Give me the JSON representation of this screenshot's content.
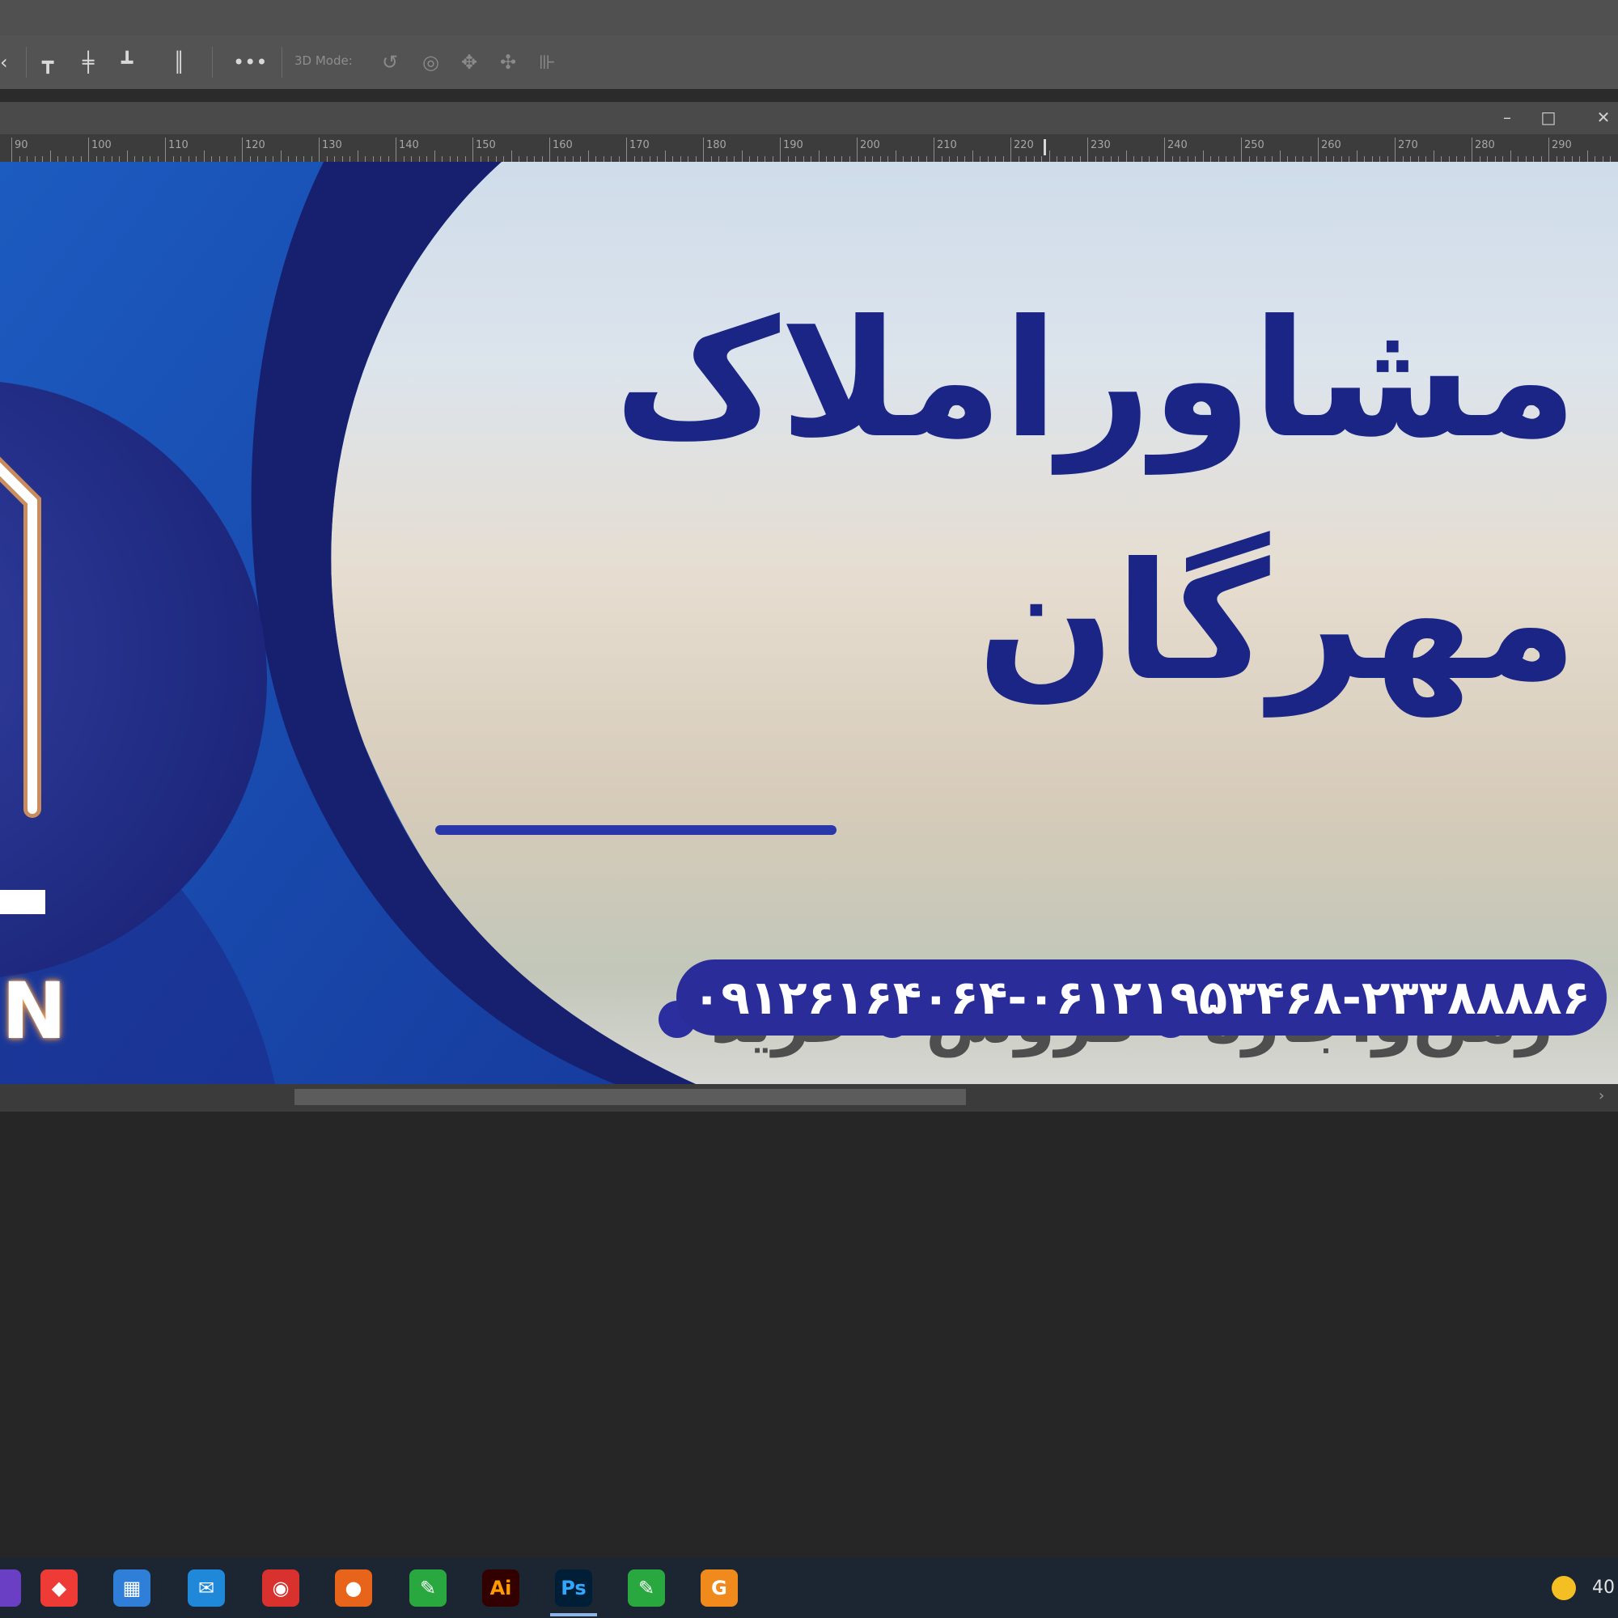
{
  "options_bar": {
    "more_label": "•••",
    "mode_label": "3D Mode:"
  },
  "window_controls": {
    "minimize": "–",
    "restore": "□",
    "close": "✕"
  },
  "ruler": {
    "labels": [
      "90",
      "100",
      "110",
      "120",
      "130",
      "140",
      "150",
      "160",
      "170",
      "180",
      "190",
      "200",
      "210",
      "220",
      "230",
      "240",
      "250",
      "260",
      "270",
      "280",
      "290"
    ]
  },
  "banner": {
    "title_line1": "مشاوراملاک",
    "title_line2": "مهرگان",
    "services": [
      "خرید",
      "فروش",
      "رهن‌واجاره"
    ],
    "phone": "۰۹۱۲۶۱۶۴۰۶۴-۰۶۱۲۱۹۵۳۴۶۸-۲۳۳۸۸۸۸۶",
    "logo_letter": "N"
  },
  "colors": {
    "banner_navy": "#1a2586",
    "banner_blue": "#1e49a8",
    "accent_dot": "#2a2e9e"
  },
  "taskbar": {
    "apps": [
      {
        "name": "app-purple-icon",
        "glyph": "",
        "color": "#6b3fc4"
      },
      {
        "name": "anydesk-icon",
        "glyph": "◆",
        "color": "#ef3b36"
      },
      {
        "name": "store-icon",
        "glyph": "▦",
        "color": "#2f7fd8"
      },
      {
        "name": "mail-icon",
        "glyph": "✉",
        "color": "#1f88d9"
      },
      {
        "name": "camera-app-icon",
        "glyph": "◉",
        "color": "#d9322e"
      },
      {
        "name": "firefox-icon",
        "glyph": "●",
        "color": "#e8641b"
      },
      {
        "name": "corel-green-icon",
        "glyph": "✎",
        "color": "#29a840"
      },
      {
        "name": "illustrator-icon",
        "glyph": "Ai",
        "color": "#330000"
      },
      {
        "name": "photoshop-icon",
        "glyph": "Ps",
        "color": "#001e36"
      },
      {
        "name": "corel-green-icon-2",
        "glyph": "✎",
        "color": "#29a840"
      },
      {
        "name": "orange-app-icon",
        "glyph": "G",
        "color": "#f08a1c"
      }
    ],
    "tray_text": "40"
  }
}
